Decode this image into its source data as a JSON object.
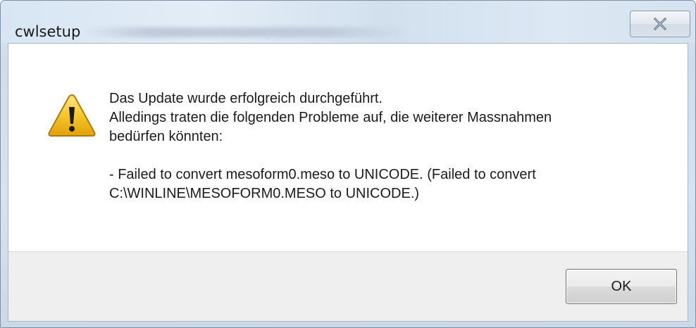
{
  "window": {
    "title": "cwlsetup",
    "close_icon": "close-icon"
  },
  "message": {
    "icon": "warning-icon",
    "lines": [
      "Das Update wurde erfolgreich durchgeführt.",
      "Alledings traten die folgenden Probleme auf, die weiterer Massnahmen",
      "bedürfen könnten:",
      "",
      "- Failed to convert mesoform0.meso to UNICODE. (Failed to convert",
      "C:\\WINLINE\\MESOFORM0.MESO to UNICODE.)"
    ]
  },
  "buttons": {
    "ok_label": "OK"
  },
  "colors": {
    "frame": "#d6e2ef",
    "button_area": "#efefef",
    "warning_yellow": "#f5c21b"
  }
}
